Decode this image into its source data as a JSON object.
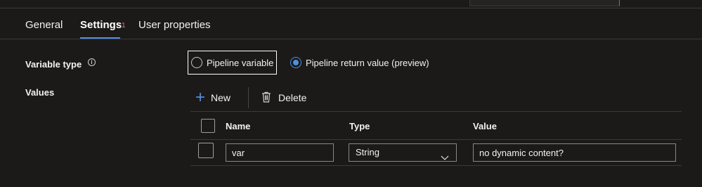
{
  "tabs": [
    {
      "label": "General"
    },
    {
      "label": "Settings",
      "badge": "1"
    },
    {
      "label": "User properties"
    }
  ],
  "variable_type": {
    "label": "Variable type",
    "info_icon": "i",
    "options": [
      {
        "label": "Pipeline variable",
        "checked": false
      },
      {
        "label": "Pipeline return value (preview)",
        "checked": true
      }
    ]
  },
  "values": {
    "label": "Values",
    "toolbar": {
      "new_label": "New",
      "delete_label": "Delete"
    },
    "columns": [
      "Name",
      "Type",
      "Value"
    ],
    "rows": [
      {
        "name": "var",
        "type": "String",
        "value": "no dynamic content?"
      }
    ]
  },
  "colors": {
    "accent": "#4f8fe0",
    "badge": "#f1707b",
    "background": "#1b1a19"
  }
}
